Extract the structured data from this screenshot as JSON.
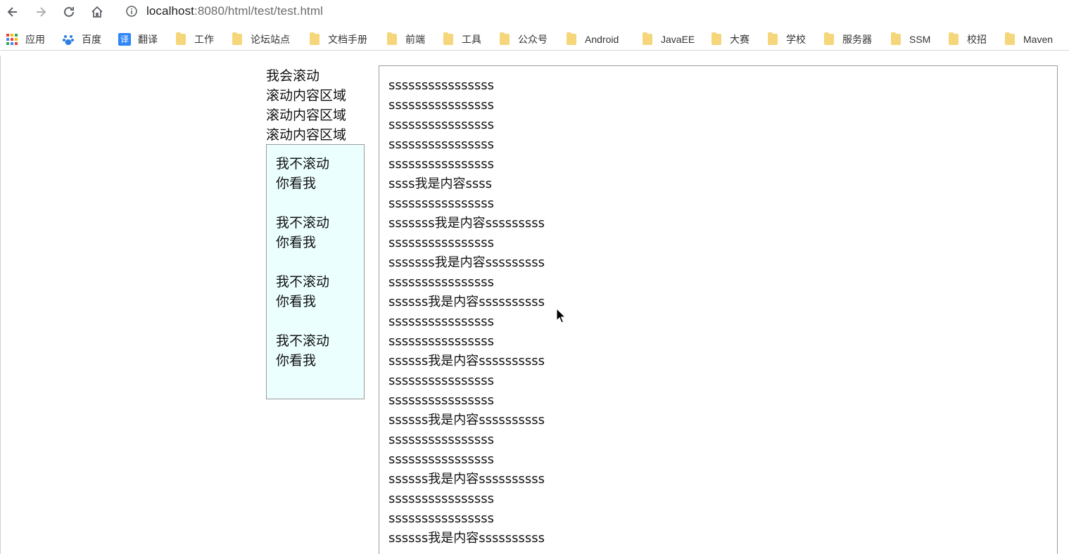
{
  "browser": {
    "url_host": "localhost",
    "url_rest": ":8080/html/test/test.html"
  },
  "bookmarks": [
    {
      "label": "应用",
      "icon": "apps-grid-icon"
    },
    {
      "label": "百度",
      "icon": "baidu-paw-icon"
    },
    {
      "label": "翻译",
      "icon": "translate-icon"
    },
    {
      "label": "工作",
      "icon": "folder-icon"
    },
    {
      "label": "论坛站点",
      "icon": "folder-icon"
    },
    {
      "label": "文档手册",
      "icon": "folder-icon"
    },
    {
      "label": "前端",
      "icon": "folder-icon"
    },
    {
      "label": "工具",
      "icon": "folder-icon"
    },
    {
      "label": "公众号",
      "icon": "folder-icon"
    },
    {
      "label": "Android",
      "icon": "folder-icon"
    },
    {
      "label": "JavaEE",
      "icon": "folder-icon"
    },
    {
      "label": "大赛",
      "icon": "folder-icon"
    },
    {
      "label": "学校",
      "icon": "folder-icon"
    },
    {
      "label": "服务器",
      "icon": "folder-icon"
    },
    {
      "label": "SSM",
      "icon": "folder-icon"
    },
    {
      "label": "校招",
      "icon": "folder-icon"
    },
    {
      "label": "Maven",
      "icon": "folder-icon"
    }
  ],
  "translate_glyph": "译",
  "scroll_area": {
    "lines": [
      "我会滚动",
      "滚动内容区域",
      "滚动内容区域",
      "滚动内容区域"
    ]
  },
  "fixed_box": {
    "groups": [
      {
        "line1": "我不滚动",
        "line2": "你看我"
      },
      {
        "line1": "我不滚动",
        "line2": "你看我"
      },
      {
        "line1": "我不滚动",
        "line2": "你看我"
      },
      {
        "line1": "我不滚动",
        "line2": "你看我"
      }
    ]
  },
  "content": {
    "lines": [
      "ssssssssssssssss",
      "ssssssssssssssss",
      "ssssssssssssssss",
      "ssssssssssssssss",
      "ssssssssssssssss",
      "ssss我是内容ssss",
      "ssssssssssssssss",
      "sssssss我是内容sssssssss",
      "ssssssssssssssss",
      "sssssss我是内容sssssssss",
      "ssssssssssssssss",
      "ssssss我是内容ssssssssss",
      "ssssssssssssssss",
      "ssssssssssssssss",
      "ssssss我是内容ssssssssss",
      "ssssssssssssssss",
      "ssssssssssssssss",
      "ssssss我是内容ssssssssss",
      "ssssssssssssssss",
      "ssssssssssssssss",
      "ssssss我是内容ssssssssss",
      "ssssssssssssssss",
      "ssssssssssssssss",
      "ssssss我是内容ssssssssss"
    ]
  }
}
